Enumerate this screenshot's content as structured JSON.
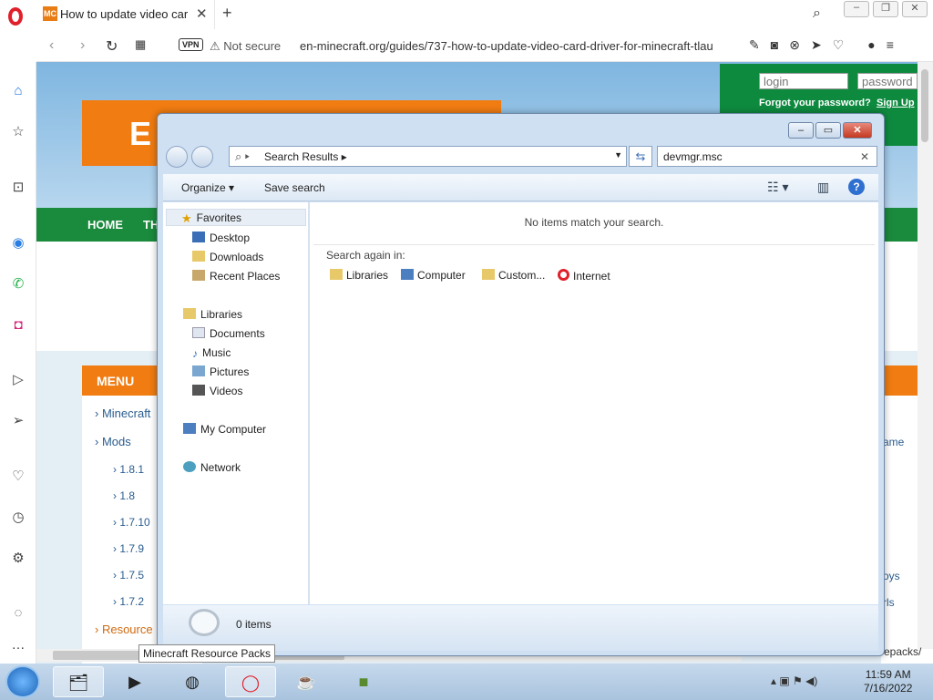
{
  "browser": {
    "tab_title": "How to update video card",
    "tab_favicon": "MC",
    "url": "en-minecraft.org/guides/737-how-to-update-video-card-driver-for-minecraft-tlau",
    "security_label": "Not secure",
    "vpn_label": "VPN"
  },
  "page": {
    "banner_text": "E",
    "login_placeholder": "login",
    "password_placeholder": "password",
    "forgot_password": "Forgot your password?",
    "sign_up": "Sign Up",
    "nav": [
      "HOME",
      "TH"
    ],
    "menu_header": "MENU",
    "menu_items": [
      "Minecraft",
      "Mods",
      "1.8.1",
      "1.8",
      "1.7.10",
      "1.7.9",
      "1.7.5",
      "1.7.2",
      "Resource"
    ],
    "right_col": [
      "ame",
      "oys",
      "rls"
    ],
    "path_tail": "epacks/",
    "tooltip": "Minecraft Resource Packs"
  },
  "explorer": {
    "breadcrumb": "Search Results",
    "search_value": "devmgr.msc",
    "toolbar": {
      "organize": "Organize",
      "save_search": "Save search"
    },
    "nav_tree": {
      "favorites": "Favorites",
      "favorites_items": [
        "Desktop",
        "Downloads",
        "Recent Places"
      ],
      "libraries": "Libraries",
      "libraries_items": [
        "Documents",
        "Music",
        "Pictures",
        "Videos"
      ],
      "computer": "My Computer",
      "network": "Network"
    },
    "no_match": "No items match your search.",
    "search_again": "Search again in:",
    "search_options": [
      "Libraries",
      "Computer",
      "Custom...",
      "Internet"
    ],
    "item_count": "0 items"
  },
  "taskbar": {
    "time": "11:59 AM",
    "date": "7/16/2022"
  },
  "colors": {
    "orange": "#f07c12",
    "green": "#1a8a3c",
    "opera_red": "#e0202b"
  }
}
